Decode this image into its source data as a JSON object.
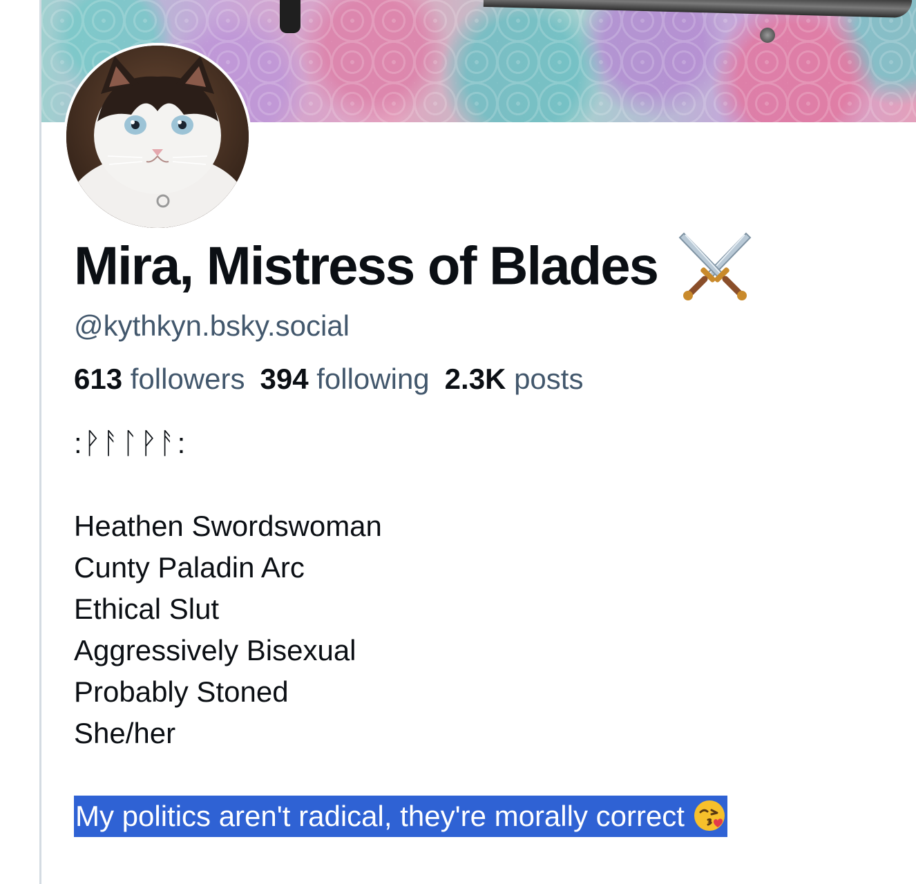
{
  "profile": {
    "display_name": "Mira, Mistress of Blades",
    "name_emoji": "crossed-swords-icon",
    "handle": "@kythkyn.bsky.social",
    "stats": {
      "followers_count": "613",
      "followers_label": "followers",
      "following_count": "394",
      "following_label": "following",
      "posts_count": "2.3K",
      "posts_label": "posts"
    },
    "bio": {
      "runes": ":ᚹᚨᛚᚹᚨ:",
      "lines": [
        "Heathen Swordswoman",
        "Cunty Paladin Arc",
        "Ethical Slut",
        "Aggressively Bisexual",
        "Probably Stoned",
        "She/her"
      ],
      "selected_line": "My politics aren't radical, they're morally correct",
      "selected_emoji": "face-blowing-kiss-icon"
    }
  },
  "colors": {
    "text_primary": "#0b0f14",
    "text_secondary": "#42576c",
    "selection": "#2f62d4",
    "border": "#d4dbe2"
  }
}
